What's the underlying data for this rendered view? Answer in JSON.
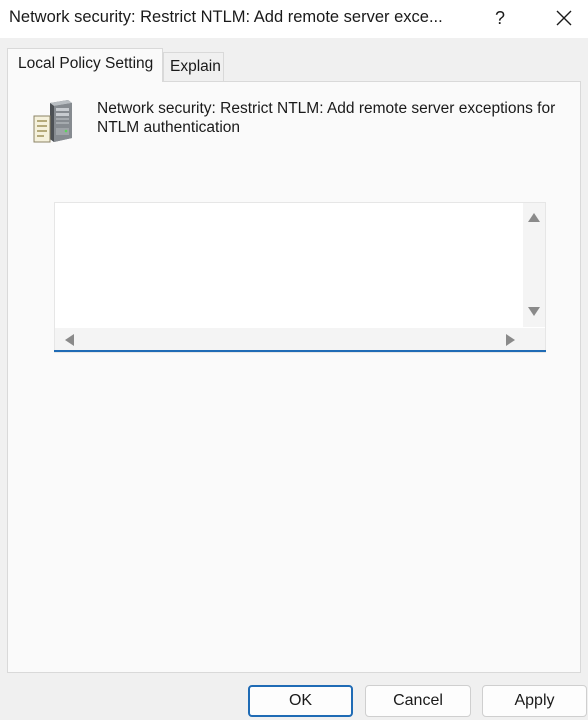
{
  "window": {
    "title": "Network security: Restrict NTLM: Add remote server exce...",
    "help_label": "?",
    "close_icon": "close-icon"
  },
  "tabs": [
    {
      "label": "Local Policy Setting",
      "active": true
    },
    {
      "label": "Explain",
      "active": false
    }
  ],
  "policy": {
    "icon": "server-icon",
    "title": "Network security: Restrict NTLM: Add remote server exceptions for NTLM authentication"
  },
  "exceptions_list": {
    "items": [],
    "accent_color": "#1f6bb5"
  },
  "buttons": {
    "ok": "OK",
    "cancel": "Cancel",
    "apply": "Apply"
  }
}
